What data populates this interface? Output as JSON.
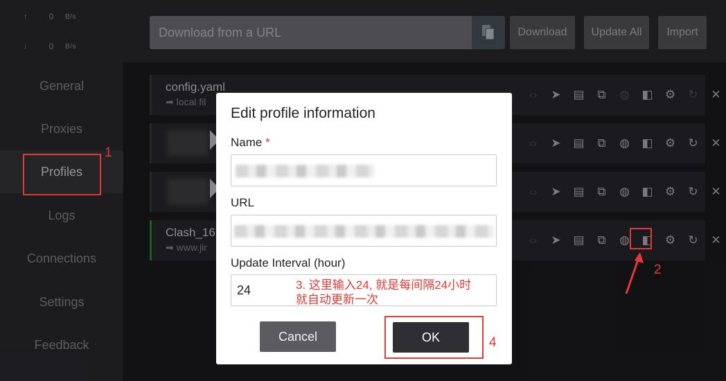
{
  "traffic": {
    "up_arrow": "↑",
    "up_value": "0",
    "up_unit": "B/s",
    "down_arrow": "↓",
    "down_value": "0",
    "down_unit": "B/s"
  },
  "nav": [
    "General",
    "Proxies",
    "Profiles",
    "Logs",
    "Connections",
    "Settings",
    "Feedback"
  ],
  "toolbar": {
    "url_placeholder": "Download from a URL",
    "download": "Download",
    "update_all": "Update All",
    "import": "Import"
  },
  "profiles": [
    {
      "name": "config.yaml",
      "sub": "➡ local fil"
    },
    {
      "name": "",
      "sub": ""
    },
    {
      "name": "",
      "sub": ""
    },
    {
      "name": "Clash_16",
      "sub": "➡ www.jir"
    }
  ],
  "dialog": {
    "title": "Edit profile information",
    "name_label": "Name",
    "required_mark": "*",
    "url_label": "URL",
    "interval_label": "Update Interval (hour)",
    "interval_value": "24",
    "cancel": "Cancel",
    "ok": "OK"
  },
  "annotations": {
    "n1": "1",
    "n2": "2",
    "n3_line1": "3. 这里输入24, 就是每间隔24小时",
    "n3_line2": "就自动更新一次",
    "n4": "4"
  },
  "colors": {
    "annotation": "#e23a35",
    "active_profile_bar": "#2f8f3c"
  }
}
